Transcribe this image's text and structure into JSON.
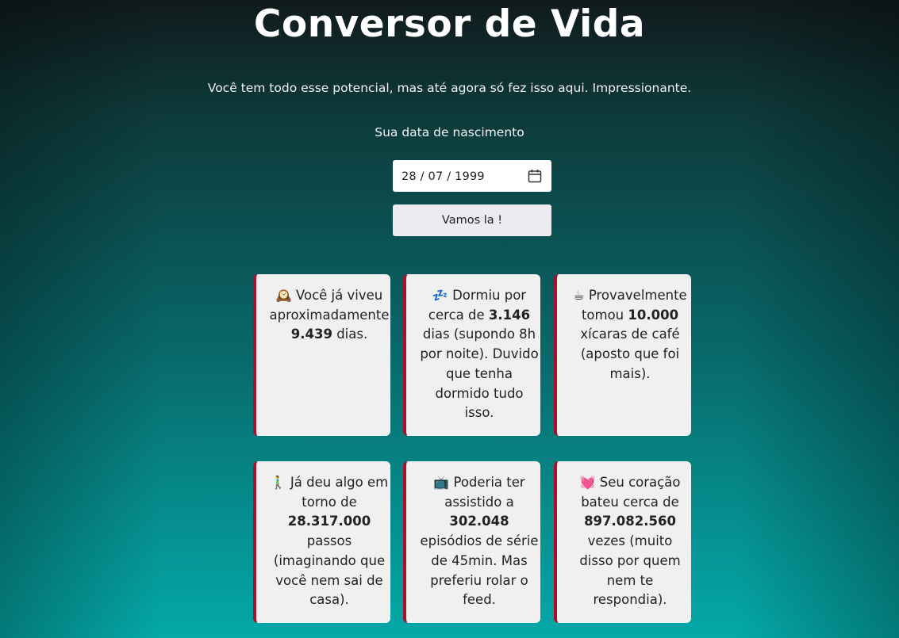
{
  "page": {
    "title": "Conversor de Vida",
    "subtitle": "Você tem todo esse potencial, mas até agora só fez isso aqui. Impressionante."
  },
  "form": {
    "birth_label": "Sua data de nascimento",
    "birth_date": "28 / 07 / 1999",
    "submit_label": "Vamos la !"
  },
  "cards": [
    {
      "icon": "alarm-clock-icon",
      "emoji": "🕰️",
      "before": " Você já viveu aproximadamente ",
      "value": "9.439",
      "after": " dias."
    },
    {
      "icon": "sleep-icon",
      "emoji": "💤",
      "before": " Dormiu por cerca de ",
      "value": "3.146",
      "after": " dias (supondo 8h por noite). Duvido que tenha dormido tudo isso."
    },
    {
      "icon": "coffee-icon",
      "emoji": "☕",
      "before": " Provavelmente tomou ",
      "value": "10.000",
      "after": " xícaras de café (aposto que foi mais)."
    },
    {
      "icon": "walking-person-icon",
      "emoji": "🚶‍♂️",
      "before": " Já deu algo em torno de ",
      "value": "28.317.000",
      "after": " passos (imaginando que você nem sai de casa)."
    },
    {
      "icon": "television-icon",
      "emoji": "📺",
      "before": " Poderia ter assistido a ",
      "value": "302.048",
      "after": " episódios de série de 45min. Mas preferiu rolar o feed."
    },
    {
      "icon": "heart-icon",
      "emoji": "💓",
      "before": " Seu coração bateu cerca de ",
      "value": "897.082.560",
      "after": " vezes (muito disso por quem nem te respondia)."
    }
  ],
  "colors": {
    "card_accent": "#a8102e",
    "card_background": "#f0f0f0",
    "background_top": "#101a1c",
    "background_bottom": "#04a9a8"
  }
}
